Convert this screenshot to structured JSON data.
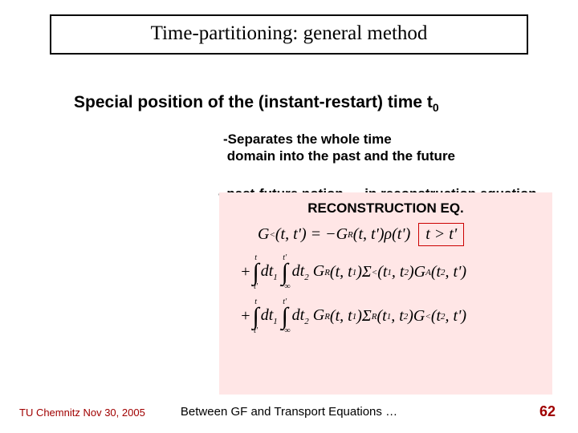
{
  "title": "Time-partitioning: general method",
  "subhead": "Special position of the (instant-restart) time t",
  "subhead_sub": "0",
  "bullet1a": "-Separates the whole time",
  "bullet1b": "domain into the past and the future",
  "bullet2": "- past-future notion … in reconstruction equation",
  "eq": {
    "title": "RECONSTRUCTION EQ.",
    "line1_lhs": "G",
    "line1_cond": "t > t'",
    "line2_plus": "+",
    "line3_plus": "+"
  },
  "footer": {
    "left": "TU Chemnitz Nov 30, 2005",
    "center": "Between GF and Transport Equations …",
    "page": "62"
  }
}
